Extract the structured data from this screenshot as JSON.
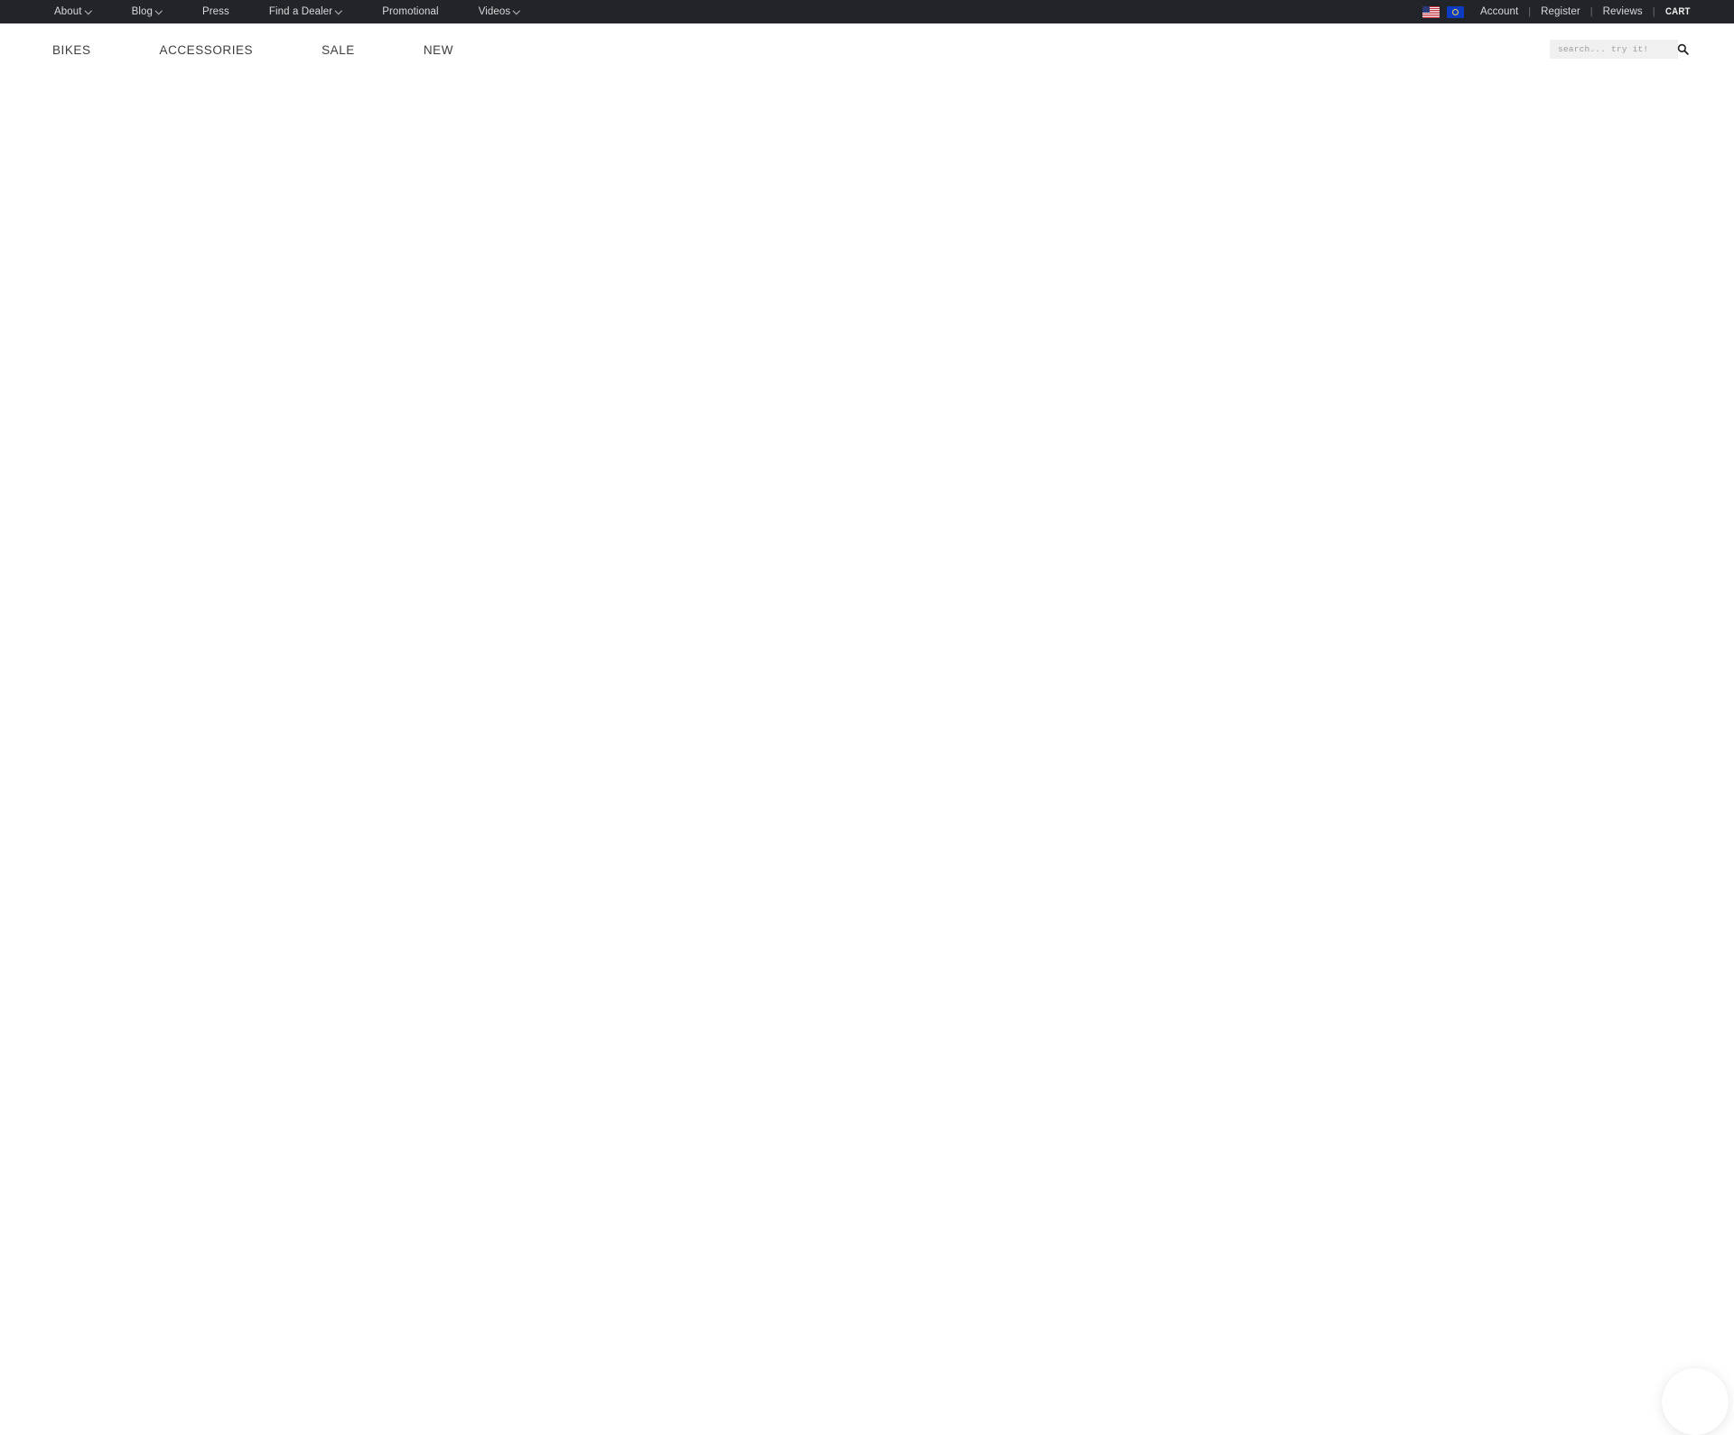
{
  "topbar": {
    "nav_items": [
      {
        "label": "About",
        "has_dropdown": true
      },
      {
        "label": "Blog",
        "has_dropdown": true
      },
      {
        "label": "Press",
        "has_dropdown": false
      },
      {
        "label": "Find a Dealer",
        "has_dropdown": true
      },
      {
        "label": "Promotional",
        "has_dropdown": false
      },
      {
        "label": "Videos",
        "has_dropdown": true
      }
    ],
    "locales": [
      {
        "name": "us-flag-icon",
        "title": "United States"
      },
      {
        "name": "eu-flag-icon",
        "title": "Europe"
      }
    ],
    "account_links": [
      {
        "label": "Account"
      },
      {
        "label": "Register"
      },
      {
        "label": "Reviews"
      }
    ],
    "separator": "|",
    "cart_label": "CART"
  },
  "mainnav": {
    "items": [
      {
        "label": "BIKES"
      },
      {
        "label": "ACCESSORIES"
      },
      {
        "label": "SALE"
      },
      {
        "label": "NEW"
      }
    ]
  },
  "search": {
    "placeholder": "search... try it!",
    "value": "",
    "icon": "search-icon"
  },
  "chat_widget": {
    "icon": "chat-bubble-icon"
  },
  "colors": {
    "topbar_bg": "#212428",
    "topbar_text": "#d9dadc",
    "page_bg": "#ffffff",
    "mainnav_text": "#3b3d40",
    "search_bg": "#f0f0f0",
    "search_placeholder": "#9a9c9e"
  }
}
